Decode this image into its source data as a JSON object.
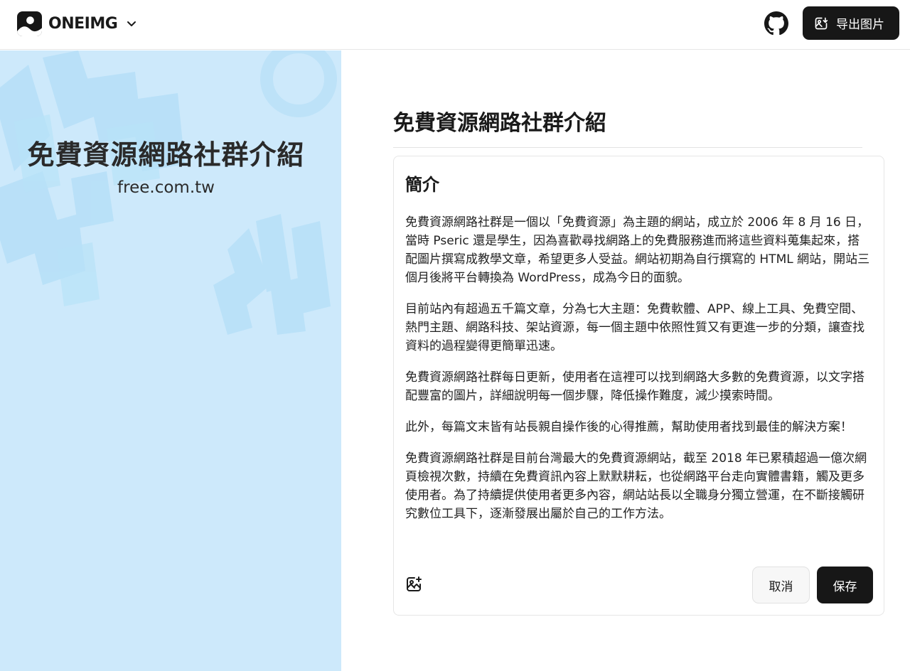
{
  "header": {
    "brand_name": "ONEIMG",
    "export_label": "导出图片",
    "icons": {
      "logo": "image-logo-icon",
      "brand_menu": "chevron-down-icon",
      "github": "github-icon",
      "export": "image-export-icon"
    }
  },
  "preview": {
    "title": "免費資源網路社群介紹",
    "subtitle": "free.com.tw",
    "background_color": "#cde9fb"
  },
  "editor": {
    "title": "免費資源網路社群介紹",
    "card": {
      "heading": "簡介",
      "paragraphs": [
        "免費資源網路社群是一個以「免費資源」為主題的網站，成立於 2006 年 8 月 16 日，當時 Pseric 還是學生，因為喜歡尋找網路上的免費服務進而將這些資料蒐集起來，搭配圖片撰寫成教學文章，希望更多人受益。網站初期為自行撰寫的 HTML 網站，開站三個月後將平台轉換為 WordPress，成為今日的面貌。",
        "目前站內有超過五千篇文章，分為七大主題：免費軟體、APP、線上工具、免費空間、熱門主題、網路科技、架站資源，每一個主題中依照性質又有更進一步的分類，讓查找資料的過程變得更簡單迅速。",
        "免費資源網路社群每日更新，使用者在這裡可以找到網路大多數的免費資源，以文字搭配豐富的圖片，詳細說明每一個步驟，降低操作難度，減少摸索時間。",
        "此外，每篇文末皆有站長親自操作後的心得推薦，幫助使用者找到最佳的解決方案！",
        "免費資源網路社群是目前台灣最大的免費資源網站，截至 2018 年已累積超過一億次網頁檢視次數，持續在免費資訊內容上默默耕耘，也從網路平台走向實體書籍，觸及更多使用者。為了持續提供使用者更多內容，網站站長以全職身分獨立營運，在不斷接觸研究數位工具下，逐漸發展出屬於自己的工作方法。"
      ],
      "add_image_icon": "image-add-icon",
      "cancel_label": "取消",
      "save_label": "保存"
    }
  },
  "colors": {
    "primary_button": "#171717",
    "preview_background": "#cde9fb"
  }
}
